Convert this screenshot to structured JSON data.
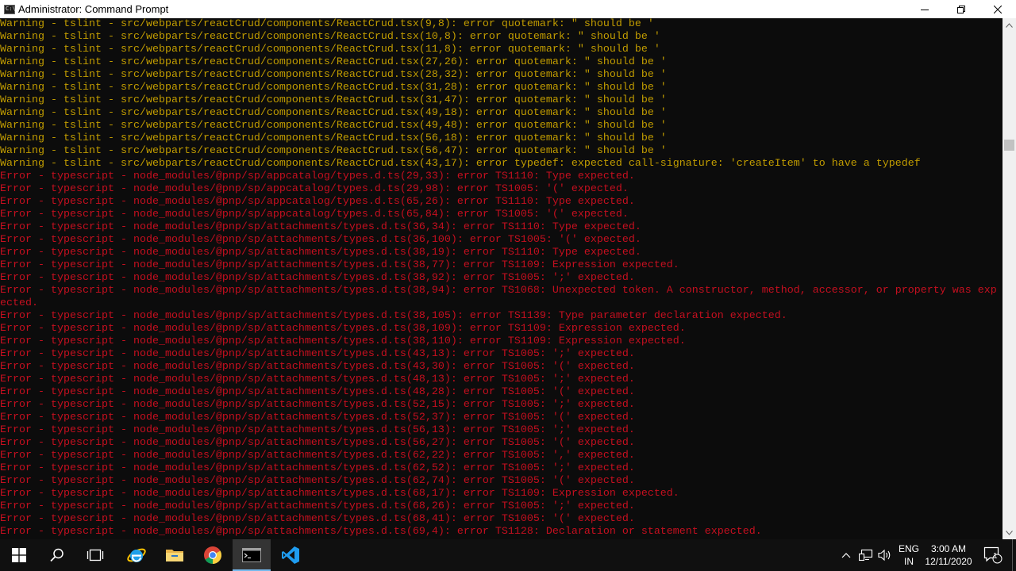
{
  "window": {
    "title": "Administrator: Command Prompt",
    "icon_label": "C:\\"
  },
  "colors": {
    "warning": "#c19c00",
    "error": "#c50f1f",
    "console_bg": "#0c0c0c",
    "taskbar_bg": "#101010",
    "accent": "#76b9ed"
  },
  "console": {
    "lines": [
      {
        "type": "warn",
        "text": "Warning - tslint - src/webparts/reactCrud/components/ReactCrud.tsx(9,8): error quotemark: \" should be '"
      },
      {
        "type": "warn",
        "text": "Warning - tslint - src/webparts/reactCrud/components/ReactCrud.tsx(10,8): error quotemark: \" should be '"
      },
      {
        "type": "warn",
        "text": "Warning - tslint - src/webparts/reactCrud/components/ReactCrud.tsx(11,8): error quotemark: \" should be '"
      },
      {
        "type": "warn",
        "text": "Warning - tslint - src/webparts/reactCrud/components/ReactCrud.tsx(27,26): error quotemark: \" should be '"
      },
      {
        "type": "warn",
        "text": "Warning - tslint - src/webparts/reactCrud/components/ReactCrud.tsx(28,32): error quotemark: \" should be '"
      },
      {
        "type": "warn",
        "text": "Warning - tslint - src/webparts/reactCrud/components/ReactCrud.tsx(31,28): error quotemark: \" should be '"
      },
      {
        "type": "warn",
        "text": "Warning - tslint - src/webparts/reactCrud/components/ReactCrud.tsx(31,47): error quotemark: \" should be '"
      },
      {
        "type": "warn",
        "text": "Warning - tslint - src/webparts/reactCrud/components/ReactCrud.tsx(49,18): error quotemark: \" should be '"
      },
      {
        "type": "warn",
        "text": "Warning - tslint - src/webparts/reactCrud/components/ReactCrud.tsx(49,48): error quotemark: \" should be '"
      },
      {
        "type": "warn",
        "text": "Warning - tslint - src/webparts/reactCrud/components/ReactCrud.tsx(56,18): error quotemark: \" should be '"
      },
      {
        "type": "warn",
        "text": "Warning - tslint - src/webparts/reactCrud/components/ReactCrud.tsx(56,47): error quotemark: \" should be '"
      },
      {
        "type": "warn",
        "text": "Warning - tslint - src/webparts/reactCrud/components/ReactCrud.tsx(43,17): error typedef: expected call-signature: 'createItem' to have a typedef"
      },
      {
        "type": "err",
        "text": "Error - typescript - node_modules/@pnp/sp/appcatalog/types.d.ts(29,33): error TS1110: Type expected."
      },
      {
        "type": "err",
        "text": "Error - typescript - node_modules/@pnp/sp/appcatalog/types.d.ts(29,98): error TS1005: '(' expected."
      },
      {
        "type": "err",
        "text": "Error - typescript - node_modules/@pnp/sp/appcatalog/types.d.ts(65,26): error TS1110: Type expected."
      },
      {
        "type": "err",
        "text": "Error - typescript - node_modules/@pnp/sp/appcatalog/types.d.ts(65,84): error TS1005: '(' expected."
      },
      {
        "type": "err",
        "text": "Error - typescript - node_modules/@pnp/sp/attachments/types.d.ts(36,34): error TS1110: Type expected."
      },
      {
        "type": "err",
        "text": "Error - typescript - node_modules/@pnp/sp/attachments/types.d.ts(36,100): error TS1005: '(' expected."
      },
      {
        "type": "err",
        "text": "Error - typescript - node_modules/@pnp/sp/attachments/types.d.ts(38,19): error TS1110: Type expected."
      },
      {
        "type": "err",
        "text": "Error - typescript - node_modules/@pnp/sp/attachments/types.d.ts(38,77): error TS1109: Expression expected."
      },
      {
        "type": "err",
        "text": "Error - typescript - node_modules/@pnp/sp/attachments/types.d.ts(38,92): error TS1005: ';' expected."
      },
      {
        "type": "err",
        "text": "Error - typescript - node_modules/@pnp/sp/attachments/types.d.ts(38,94): error TS1068: Unexpected token. A constructor, method, accessor, or property was exp"
      },
      {
        "type": "err",
        "text": "ected."
      },
      {
        "type": "err",
        "text": "Error - typescript - node_modules/@pnp/sp/attachments/types.d.ts(38,105): error TS1139: Type parameter declaration expected."
      },
      {
        "type": "err",
        "text": "Error - typescript - node_modules/@pnp/sp/attachments/types.d.ts(38,109): error TS1109: Expression expected."
      },
      {
        "type": "err",
        "text": "Error - typescript - node_modules/@pnp/sp/attachments/types.d.ts(38,110): error TS1109: Expression expected."
      },
      {
        "type": "err",
        "text": "Error - typescript - node_modules/@pnp/sp/attachments/types.d.ts(43,13): error TS1005: ';' expected."
      },
      {
        "type": "err",
        "text": "Error - typescript - node_modules/@pnp/sp/attachments/types.d.ts(43,30): error TS1005: '(' expected."
      },
      {
        "type": "err",
        "text": "Error - typescript - node_modules/@pnp/sp/attachments/types.d.ts(48,13): error TS1005: ';' expected."
      },
      {
        "type": "err",
        "text": "Error - typescript - node_modules/@pnp/sp/attachments/types.d.ts(48,28): error TS1005: '(' expected."
      },
      {
        "type": "err",
        "text": "Error - typescript - node_modules/@pnp/sp/attachments/types.d.ts(52,15): error TS1005: ';' expected."
      },
      {
        "type": "err",
        "text": "Error - typescript - node_modules/@pnp/sp/attachments/types.d.ts(52,37): error TS1005: '(' expected."
      },
      {
        "type": "err",
        "text": "Error - typescript - node_modules/@pnp/sp/attachments/types.d.ts(56,13): error TS1005: ';' expected."
      },
      {
        "type": "err",
        "text": "Error - typescript - node_modules/@pnp/sp/attachments/types.d.ts(56,27): error TS1005: '(' expected."
      },
      {
        "type": "err",
        "text": "Error - typescript - node_modules/@pnp/sp/attachments/types.d.ts(62,22): error TS1005: ',' expected."
      },
      {
        "type": "err",
        "text": "Error - typescript - node_modules/@pnp/sp/attachments/types.d.ts(62,52): error TS1005: ';' expected."
      },
      {
        "type": "err",
        "text": "Error - typescript - node_modules/@pnp/sp/attachments/types.d.ts(62,74): error TS1005: '(' expected."
      },
      {
        "type": "err",
        "text": "Error - typescript - node_modules/@pnp/sp/attachments/types.d.ts(68,17): error TS1109: Expression expected."
      },
      {
        "type": "err",
        "text": "Error - typescript - node_modules/@pnp/sp/attachments/types.d.ts(68,26): error TS1005: ';' expected."
      },
      {
        "type": "err",
        "text": "Error - typescript - node_modules/@pnp/sp/attachments/types.d.ts(68,41): error TS1005: '(' expected."
      },
      {
        "type": "err",
        "text": "Error - typescript - node_modules/@pnp/sp/attachments/types.d.ts(69,4): error TS1128: Declaration or statement expected."
      }
    ]
  },
  "taskbar": {
    "items": [
      {
        "name": "start-button",
        "icon": "windows-logo-icon",
        "active": false
      },
      {
        "name": "search-button",
        "icon": "search-icon",
        "active": false
      },
      {
        "name": "task-view-button",
        "icon": "task-view-icon",
        "active": false
      },
      {
        "name": "taskbar-internet-explorer",
        "icon": "internet-explorer-icon",
        "active": false
      },
      {
        "name": "taskbar-file-explorer",
        "icon": "folder-icon",
        "active": false
      },
      {
        "name": "taskbar-chrome",
        "icon": "chrome-icon",
        "active": false
      },
      {
        "name": "taskbar-command-prompt",
        "icon": "command-prompt-icon",
        "active": true
      },
      {
        "name": "taskbar-vscode",
        "icon": "vscode-icon",
        "active": false
      }
    ],
    "tray": {
      "language_primary": "ENG",
      "language_secondary": "IN",
      "time": "3:00 AM",
      "date": "12/11/2020",
      "notification_count": "1"
    }
  }
}
